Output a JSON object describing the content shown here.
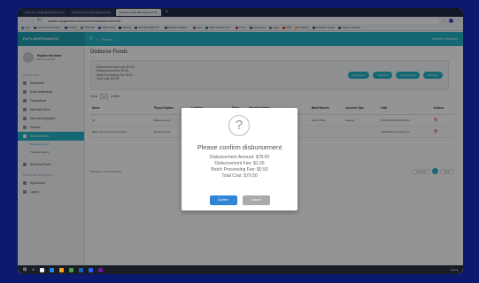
{
  "browser": {
    "tabs": [
      {
        "label": "Inbox (2) - dearly@example.com",
        "active": false
      },
      {
        "label": "Paylane Online Management Sy",
        "active": false
      },
      {
        "label": "Paylane Online Management Sy",
        "active": true
      }
    ],
    "url": "paylane.qsupported.solutions/merchant/disbursements",
    "bookmarks": [
      "Apps",
      "bank transit numbers",
      "PropPay",
      "XMS Edu",
      "MSKit portal",
      "Website",
      "Standard Bank Ch...",
      "Standard Registe...",
      "Login",
      "Daily Operational T...",
      "Demo",
      "paylane QA",
      "Login",
      "DOB",
      "Kinda PF",
      "Feedback issues",
      "Feature manager"
    ]
  },
  "header": {
    "brand": "PAYLANEFINANCE",
    "search_placeholder": "Search...",
    "user_label": "Welcome Merchant"
  },
  "sidebar": {
    "user_name": "Paylane Merchant",
    "user_role": "Merchant Admin",
    "section_merchant": "MERCHANT",
    "items": [
      {
        "label": "Dashboard"
      },
      {
        "label": "Bank Settlements"
      },
      {
        "label": "Transactions"
      },
      {
        "label": "Merchant Users"
      },
      {
        "label": "Merchant Managers"
      },
      {
        "label": "Invoices"
      },
      {
        "label": "Disbursements"
      }
    ],
    "subitems": [
      {
        "label": "Disburse Funds"
      },
      {
        "label": "Transfer History"
      }
    ],
    "items2": [
      {
        "label": "Recurring Funds"
      }
    ],
    "section_account": "ACCOUNT SETTINGS",
    "items3": [
      {
        "label": "My Account"
      },
      {
        "label": "Logout"
      }
    ]
  },
  "main": {
    "title": "Disburse Funds",
    "summary": {
      "line1": "Disbursement Amount: $78.00",
      "line2": "Disbursement Fee: $1.00",
      "line3": "Batch Processing Fee: $0.50",
      "line4": "Total Cost: $79.50"
    },
    "actions": [
      "Add Payee",
      "Add Row",
      "Bulk Payees",
      "Disburse"
    ],
    "controls": {
      "show": "Show",
      "value": "10",
      "entries": "entries"
    },
    "columns": [
      "Name",
      "Payout Option",
      "Location",
      "Bank",
      "Recipient Bank",
      "Bank Branch",
      "Account Type",
      "Date",
      "Actions"
    ],
    "rows": [
      {
        "name": "BJ",
        "option": "Bank Account",
        "location": "Unit 1 Trails Jamin",
        "bank": "",
        "recipient_bank": "Capital Land at The Bahamas",
        "branch": "Head Office",
        "type": "savings",
        "date": "2021/02/16 10:03:58 pm"
      },
      {
        "name": "Bahamas James Investments",
        "option": "Bank Account",
        "location": "",
        "bank": "",
        "recipient_bank": "",
        "branch": "",
        "type": "",
        "date": "2021/02/16 11:36:09 pm"
      }
    ],
    "footer_note": "Showing 1 to 2 of 2 entries",
    "pager": {
      "prev": "Previous",
      "current": "1",
      "next": "Next"
    },
    "copyright_left": "All rights reserved.",
    "copyright_right": "2020 © Copyright Paylane"
  },
  "modal": {
    "icon_glyph": "?",
    "title": "Please confirm disbursement",
    "line1": "Disbursement Amount: $78.00",
    "line2": "Disbursement Fee: $1.00",
    "line3": "Batch Processing Fee: $0.50",
    "line4": "Total Cost: $79.50",
    "confirm_label": "Confirm",
    "cancel_label": "Cancel"
  },
  "colors": {
    "accent": "#22b3c7",
    "confirm": "#3085d6",
    "cancel": "#aaaaaa",
    "background": "#0b1a6e"
  },
  "icons": [
    "search-icon",
    "menu-icon",
    "question-icon",
    "delete-icon",
    "windows-start-icon"
  ]
}
